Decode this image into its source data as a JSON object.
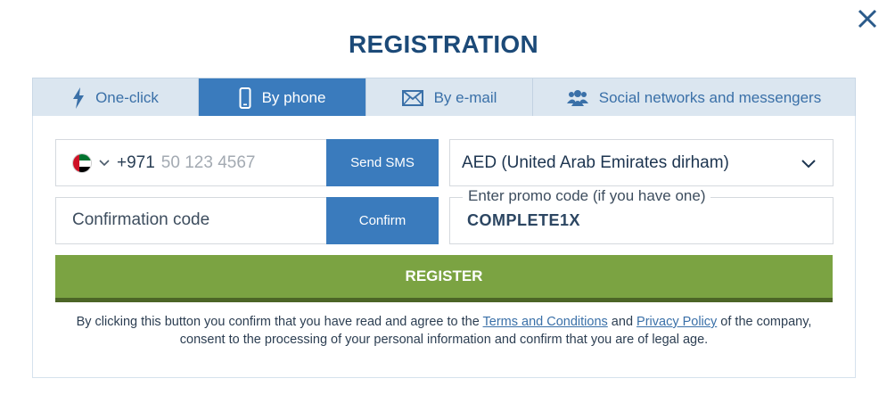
{
  "modal": {
    "title": "REGISTRATION",
    "close_icon": "close-icon"
  },
  "tabs": [
    {
      "label": "One-click",
      "icon": "lightning-icon",
      "active": false
    },
    {
      "label": "By phone",
      "icon": "smartphone-icon",
      "active": true
    },
    {
      "label": "By e-mail",
      "icon": "envelope-icon",
      "active": false
    },
    {
      "label": "Social networks and messengers",
      "icon": "users-icon",
      "active": false
    }
  ],
  "phone": {
    "country_flag": "uae-flag-icon",
    "dial_code": "+971",
    "placeholder": "50 123 4567",
    "value": "",
    "send_sms_label": "Send SMS"
  },
  "confirmation": {
    "placeholder": "Confirmation code",
    "value": "",
    "confirm_label": "Confirm"
  },
  "currency": {
    "selected": "AED (United Arab Emirates dirham)"
  },
  "promo": {
    "label": "Enter promo code (if you have one)",
    "value": "COMPLETE1X"
  },
  "register_label": "REGISTER",
  "legal": {
    "before_terms": "By clicking this button you confirm that you have read and agree to the ",
    "terms_link": "Terms and Conditions",
    "and_text": " and ",
    "privacy_link": "Privacy Policy",
    "after_privacy": " of the company, consent to the processing of your personal information and confirm that you are of legal age."
  },
  "colors": {
    "brand_blue": "#3a7bbd",
    "title_blue": "#1c4a78",
    "register_green": "#7ba342",
    "tab_bg": "#dbe6f0"
  }
}
